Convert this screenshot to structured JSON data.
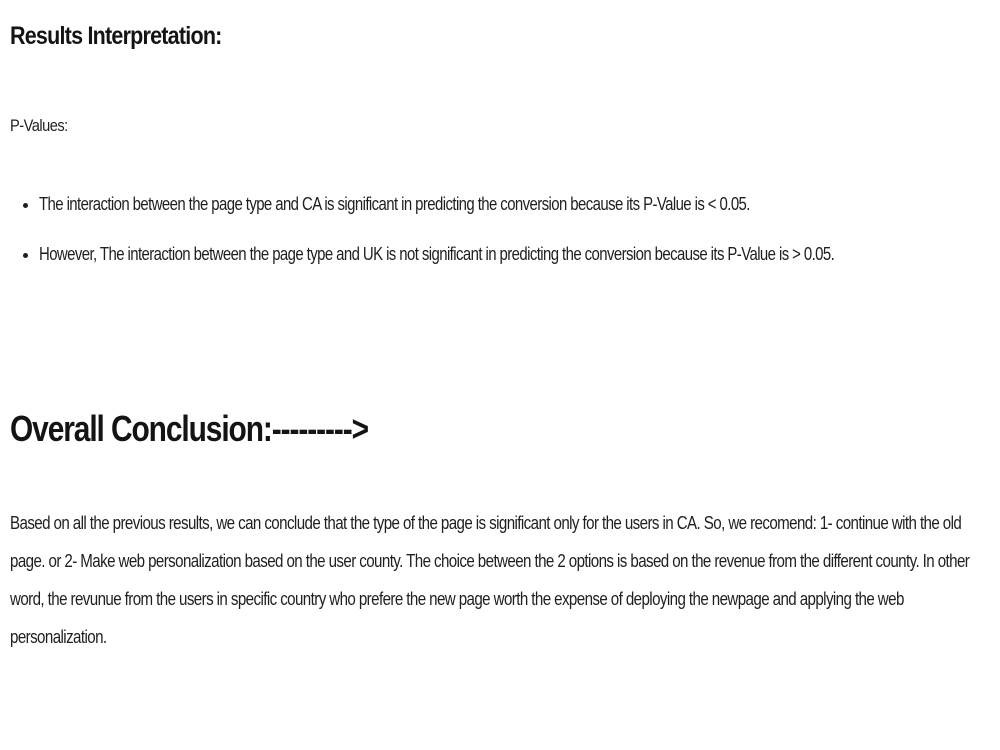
{
  "results": {
    "heading": "Results Interpretation:",
    "pvalues_label": "P-Values:",
    "bullets": [
      "The interaction between the page type and CA is significant in predicting the conversion because its P-Value is < 0.05.",
      "However, The interaction between the page type and UK is not significant in predicting the conversion because its P-Value is > 0.05."
    ]
  },
  "conclusion": {
    "heading": "Overall Conclusion:--------->",
    "body": "Based on all the previous results, we can conclude that the type of the page is significant only for the users in CA. So, we recomend: 1- continue with the old page. or 2- Make web personalization based on the user county. The choice between the 2 options is based on the revenue from the different county. In other word, the revunue from the users in specific country who prefere the new page worth the expense of deploying the newpage and applying the web personalization."
  }
}
